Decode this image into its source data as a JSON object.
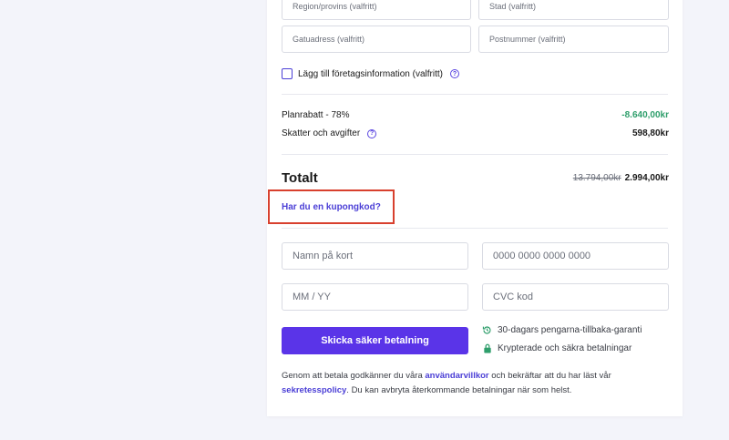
{
  "address": {
    "region_placeholder": "Region/provins (valfritt)",
    "city_placeholder": "Stad (valfritt)",
    "street_placeholder": "Gatuadress (valfritt)",
    "postal_placeholder": "Postnummer (valfritt)"
  },
  "company": {
    "checkbox_label": "Lägg till företagsinformation (valfritt)",
    "help_icon": "question-circle-icon",
    "help_glyph": "?"
  },
  "summary": {
    "discount_label": "Planrabatt - 78%",
    "discount_value": "-8.640,00kr",
    "tax_label": "Skatter och avgifter",
    "tax_value": "598,80kr",
    "total_label": "Totalt",
    "original_total": "13.794,00kr",
    "final_total": "2.994,00kr",
    "discount_color": "#2e9e6b"
  },
  "coupon": {
    "link_label": "Har du en kupongkod?"
  },
  "card_form": {
    "name_placeholder": "Namn på kort",
    "number_placeholder": "0000 0000 0000 0000",
    "expiry_placeholder": "MM / YY",
    "cvc_placeholder": "CVC kod"
  },
  "payment": {
    "button_label": "Skicka säker betalning",
    "button_color": "#5a34e8"
  },
  "features": [
    {
      "icon": "money-back-icon",
      "text": "30-dagars pengarna-tillbaka-garanti"
    },
    {
      "icon": "lock-icon",
      "text": "Krypterade och säkra betalningar"
    }
  ],
  "terms": {
    "prefix": "Genom att betala godkänner du våra ",
    "terms_link": "användarvillkor",
    "middle": " och bekräftar att du har läst vår",
    "privacy_link": "sekretesspolicy",
    "suffix": ". Du kan avbryta återkommande betalningar när som helst."
  }
}
